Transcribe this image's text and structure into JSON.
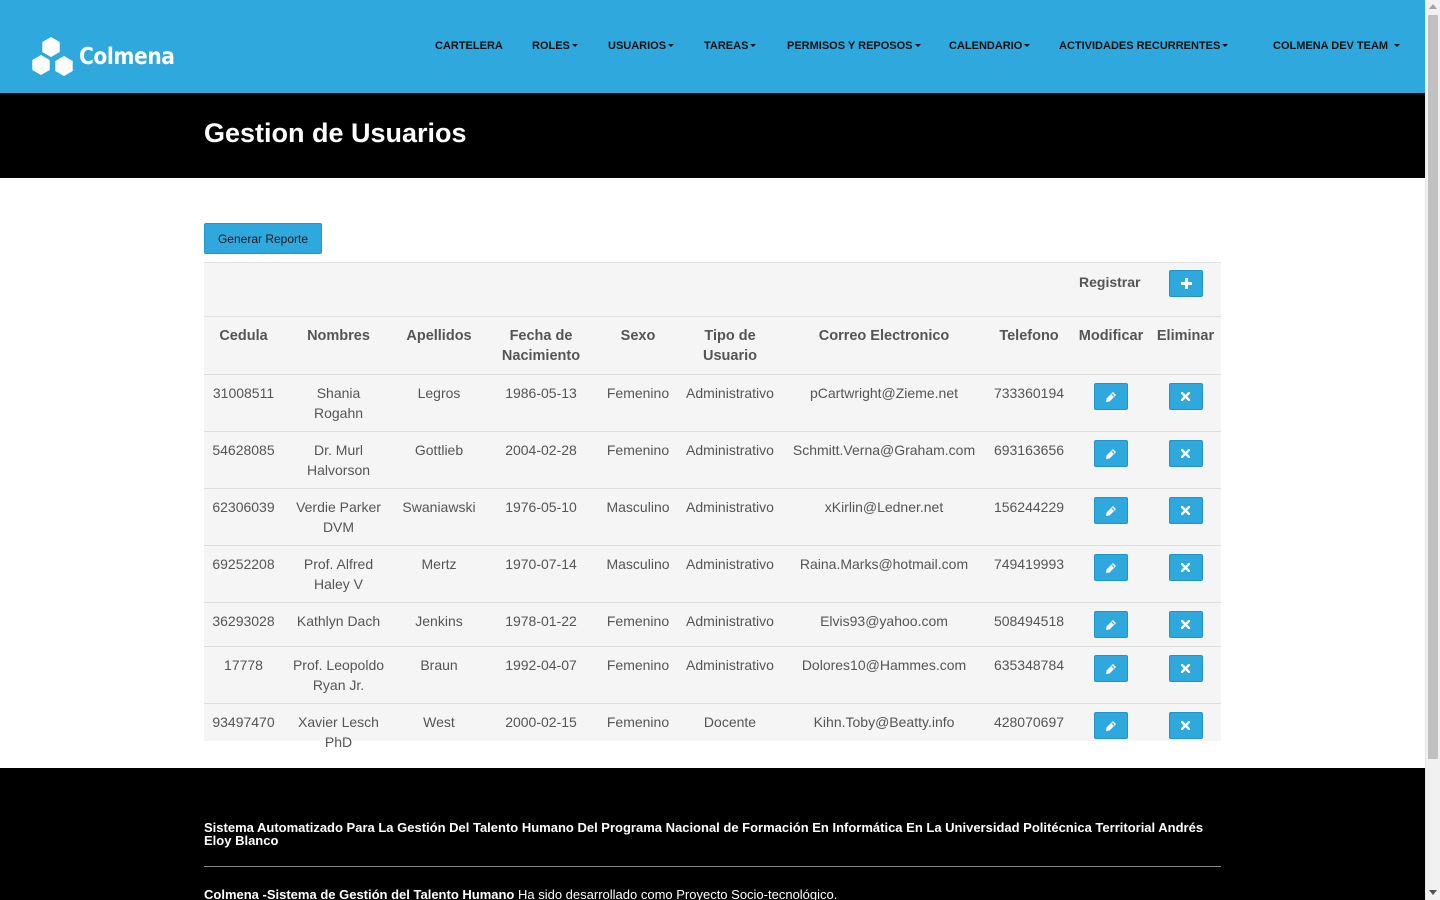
{
  "app": {
    "brand": "Colmena"
  },
  "nav": {
    "items": [
      {
        "label": "CARTELERA",
        "dropdown": false
      },
      {
        "label": "ROLES",
        "dropdown": true
      },
      {
        "label": "USUARIOS",
        "dropdown": true
      },
      {
        "label": "TAREAS",
        "dropdown": true
      },
      {
        "label": "PERMISOS Y REPOSOS",
        "dropdown": true
      },
      {
        "label": "CALENDARIO",
        "dropdown": true
      },
      {
        "label": "ACTIVIDADES RECURRENTES",
        "dropdown": true
      }
    ],
    "user": "COLMENA DEV TEAM"
  },
  "page": {
    "title": "Gestion de Usuarios"
  },
  "toolbar": {
    "report_label": "Generar Reporte",
    "register_label": "Registrar"
  },
  "table": {
    "headers": {
      "cedula": "Cedula",
      "nombres": "Nombres",
      "apellidos": "Apellidos",
      "fecha_l1": "Fecha de",
      "fecha_l2": "Nacimiento",
      "sexo": "Sexo",
      "tipo_l1": "Tipo de",
      "tipo_l2": "Usuario",
      "correo": "Correo Electronico",
      "telefono": "Telefono",
      "modificar": "Modificar",
      "eliminar": "Eliminar"
    },
    "rows": [
      {
        "cedula": "31008511",
        "nombres_l1": "Shania",
        "nombres_l2": "Rogahn",
        "apellidos": "Legros",
        "fecha": "1986-05-13",
        "sexo": "Femenino",
        "tipo": "Administrativo",
        "correo": "pCartwright@Zieme.net",
        "telefono": "733360194"
      },
      {
        "cedula": "54628085",
        "nombres_l1": "Dr. Murl",
        "nombres_l2": "Halvorson",
        "apellidos": "Gottlieb",
        "fecha": "2004-02-28",
        "sexo": "Femenino",
        "tipo": "Administrativo",
        "correo": "Schmitt.Verna@Graham.com",
        "telefono": "693163656"
      },
      {
        "cedula": "62306039",
        "nombres_l1": "Verdie Parker",
        "nombres_l2": "DVM",
        "apellidos": "Swaniawski",
        "fecha": "1976-05-10",
        "sexo": "Masculino",
        "tipo": "Administrativo",
        "correo": "xKirlin@Ledner.net",
        "telefono": "156244229"
      },
      {
        "cedula": "69252208",
        "nombres_l1": "Prof. Alfred",
        "nombres_l2": "Haley V",
        "apellidos": "Mertz",
        "fecha": "1970-07-14",
        "sexo": "Masculino",
        "tipo": "Administrativo",
        "correo": "Raina.Marks@hotmail.com",
        "telefono": "749419993"
      },
      {
        "cedula": "36293028",
        "nombres_l1": "Kathlyn Dach",
        "nombres_l2": "",
        "apellidos": "Jenkins",
        "fecha": "1978-01-22",
        "sexo": "Femenino",
        "tipo": "Administrativo",
        "correo": "Elvis93@yahoo.com",
        "telefono": "508494518"
      },
      {
        "cedula": "17778",
        "nombres_l1": "Prof. Leopoldo",
        "nombres_l2": "Ryan Jr.",
        "apellidos": "Braun",
        "fecha": "1992-04-07",
        "sexo": "Femenino",
        "tipo": "Administrativo",
        "correo": "Dolores10@Hammes.com",
        "telefono": "635348784"
      },
      {
        "cedula": "93497470",
        "nombres_l1": "Xavier Lesch",
        "nombres_l2": "PhD",
        "apellidos": "West",
        "fecha": "2000-02-15",
        "sexo": "Femenino",
        "tipo": "Docente",
        "correo": "Kihn.Toby@Beatty.info",
        "telefono": "428070697"
      }
    ]
  },
  "footer": {
    "title": "Sistema Automatizado Para La Gestión Del Talento Humano Del Programa Nacional de Formación En Informática En La Universidad Politécnica Territorial Andrés Eloy Blanco",
    "credit_bold": "Colmena -Sistema de Gestión del Talento Humano",
    "credit_rest": " Ha sido desarrollado como Proyecto Socio-tecnológico."
  },
  "colors": {
    "primary": "#2fa8de",
    "dark": "#000000",
    "text": "#555555"
  },
  "icons": {
    "add": "plus-icon",
    "edit": "pencil-icon",
    "delete": "times-icon"
  }
}
